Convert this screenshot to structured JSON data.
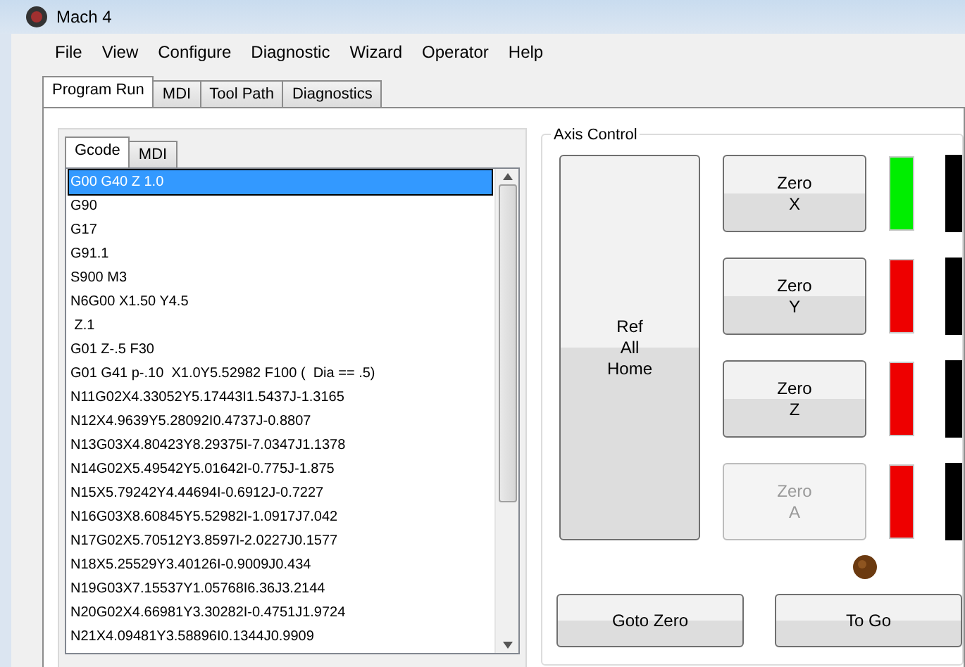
{
  "window": {
    "title": "Mach 4"
  },
  "menu": [
    "File",
    "View",
    "Configure",
    "Diagnostic",
    "Wizard",
    "Operator",
    "Help"
  ],
  "tabs": [
    {
      "label": "Program Run",
      "selected": true
    },
    {
      "label": "MDI",
      "selected": false
    },
    {
      "label": "Tool Path",
      "selected": false
    },
    {
      "label": "Diagnostics",
      "selected": false
    }
  ],
  "gcode_panel": {
    "tabs": [
      {
        "label": "Gcode",
        "selected": true
      },
      {
        "label": "MDI",
        "selected": false
      }
    ],
    "lines": [
      {
        "text": "G00 G40 Z 1.0",
        "selected": true
      },
      {
        "text": "G90",
        "selected": false
      },
      {
        "text": "G17",
        "selected": false
      },
      {
        "text": "G91.1",
        "selected": false
      },
      {
        "text": "S900 M3",
        "selected": false
      },
      {
        "text": "N6G00 X1.50 Y4.5",
        "selected": false
      },
      {
        "text": " Z.1",
        "selected": false
      },
      {
        "text": "G01 Z-.5 F30",
        "selected": false
      },
      {
        "text": "G01 G41 p-.10  X1.0Y5.52982 F100 (  Dia == .5)",
        "selected": false
      },
      {
        "text": "N11G02X4.33052Y5.17443I1.5437J-1.3165",
        "selected": false
      },
      {
        "text": "N12X4.9639Y5.28092I0.4737J-0.8807",
        "selected": false
      },
      {
        "text": "N13G03X4.80423Y8.29375I-7.0347J1.1378",
        "selected": false
      },
      {
        "text": "N14G02X5.49542Y5.01642I-0.775J-1.875",
        "selected": false
      },
      {
        "text": "N15X5.79242Y4.44694I-0.6912J-0.7227",
        "selected": false
      },
      {
        "text": "N16G03X8.60845Y5.52982I-1.0917J7.042",
        "selected": false
      },
      {
        "text": "N17G02X5.70512Y3.8597I-2.0227J0.1577",
        "selected": false
      },
      {
        "text": "N18X5.25529Y3.40126I-0.9009J0.434",
        "selected": false
      },
      {
        "text": "N19G03X7.15537Y1.05768I6.36J3.2144",
        "selected": false
      },
      {
        "text": "N20G02X4.66981Y3.30282I-0.4751J1.9724",
        "selected": false
      },
      {
        "text": "N21X4.09481Y3.58896I0.1344J0.9909",
        "selected": false
      }
    ]
  },
  "axis_control": {
    "title": "Axis Control",
    "ref_button": [
      "Ref",
      "All",
      "Home"
    ],
    "axes": [
      {
        "label": "Zero",
        "axis": "X",
        "disabled": false,
        "color": "#00ee00"
      },
      {
        "label": "Zero",
        "axis": "Y",
        "disabled": false,
        "color": "#ee0000"
      },
      {
        "label": "Zero",
        "axis": "Z",
        "disabled": false,
        "color": "#ee0000"
      },
      {
        "label": "Zero",
        "axis": "A",
        "disabled": true,
        "color": "#ee0000"
      }
    ],
    "goto_zero_button": "Goto Zero",
    "to_go_button": "To Go"
  }
}
